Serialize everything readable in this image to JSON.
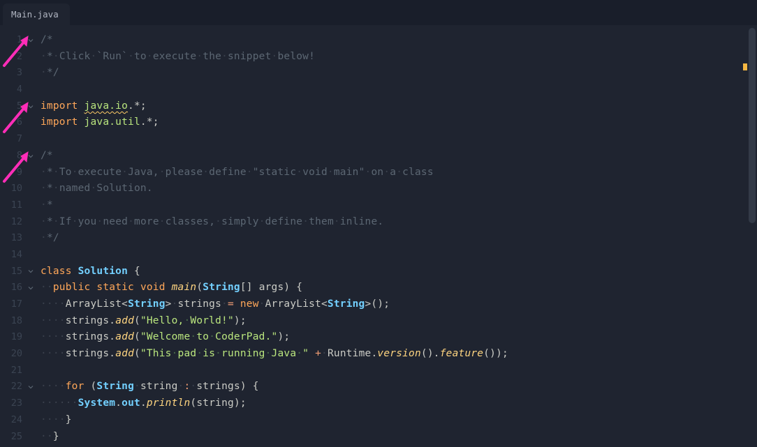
{
  "tab": {
    "filename": "Main.java"
  },
  "lines": [
    {
      "num": 1,
      "fold": true,
      "tokens": [
        [
          "c-comment",
          "/*"
        ]
      ]
    },
    {
      "num": 2,
      "fold": false,
      "tokens": [
        [
          "c-comment",
          " * Click `Run` to execute the snippet below!"
        ]
      ]
    },
    {
      "num": 3,
      "fold": false,
      "tokens": [
        [
          "c-comment",
          " */"
        ]
      ]
    },
    {
      "num": 4,
      "fold": false,
      "tokens": []
    },
    {
      "num": 5,
      "fold": true,
      "tokens": [
        [
          "c-key",
          "import"
        ],
        [
          "c-plain",
          " "
        ],
        [
          "c-ns warn-underline",
          "java.io"
        ],
        [
          "c-punct",
          ".*;"
        ]
      ]
    },
    {
      "num": 6,
      "fold": false,
      "tokens": [
        [
          "c-key",
          "import"
        ],
        [
          "c-plain",
          " "
        ],
        [
          "c-ns",
          "java.util"
        ],
        [
          "c-punct",
          ".*;"
        ]
      ]
    },
    {
      "num": 7,
      "fold": false,
      "tokens": []
    },
    {
      "num": 8,
      "fold": true,
      "tokens": [
        [
          "c-comment",
          "/*"
        ]
      ]
    },
    {
      "num": 9,
      "fold": false,
      "tokens": [
        [
          "c-comment",
          " * To execute Java, please define \"static void main\" on a class"
        ]
      ]
    },
    {
      "num": 10,
      "fold": false,
      "tokens": [
        [
          "c-comment",
          " * named Solution."
        ]
      ]
    },
    {
      "num": 11,
      "fold": false,
      "tokens": [
        [
          "c-comment",
          " *"
        ]
      ]
    },
    {
      "num": 12,
      "fold": false,
      "tokens": [
        [
          "c-comment",
          " * If you need more classes, simply define them inline."
        ]
      ]
    },
    {
      "num": 13,
      "fold": false,
      "tokens": [
        [
          "c-comment",
          " */"
        ]
      ]
    },
    {
      "num": 14,
      "fold": false,
      "tokens": []
    },
    {
      "num": 15,
      "fold": true,
      "tokens": [
        [
          "c-key",
          "class"
        ],
        [
          "c-plain",
          " "
        ],
        [
          "c-type",
          "Solution"
        ],
        [
          "c-plain",
          " "
        ],
        [
          "c-punct",
          "{"
        ]
      ]
    },
    {
      "num": 16,
      "fold": true,
      "indent": 1,
      "tokens": [
        [
          "c-key",
          "public"
        ],
        [
          "c-plain",
          " "
        ],
        [
          "c-key",
          "static"
        ],
        [
          "c-plain",
          " "
        ],
        [
          "c-key",
          "void"
        ],
        [
          "c-plain",
          " "
        ],
        [
          "c-meth-def",
          "main"
        ],
        [
          "c-punct",
          "("
        ],
        [
          "c-type",
          "String"
        ],
        [
          "c-punct",
          "[]"
        ],
        [
          "c-plain",
          " "
        ],
        [
          "c-plain",
          "args"
        ],
        [
          "c-punct",
          ")"
        ],
        [
          "c-plain",
          " "
        ],
        [
          "c-punct",
          "{"
        ]
      ]
    },
    {
      "num": 17,
      "fold": false,
      "indent": 2,
      "tokens": [
        [
          "c-plain",
          "ArrayList"
        ],
        [
          "c-punct",
          "<"
        ],
        [
          "c-type",
          "String"
        ],
        [
          "c-punct",
          ">"
        ],
        [
          "c-plain",
          " strings "
        ],
        [
          "c-op",
          "="
        ],
        [
          "c-plain",
          " "
        ],
        [
          "c-key",
          "new"
        ],
        [
          "c-plain",
          " ArrayList"
        ],
        [
          "c-punct",
          "<"
        ],
        [
          "c-type",
          "String"
        ],
        [
          "c-punct",
          ">();"
        ]
      ]
    },
    {
      "num": 18,
      "fold": false,
      "indent": 2,
      "tokens": [
        [
          "c-plain",
          "strings"
        ],
        [
          "c-punct",
          "."
        ],
        [
          "c-meth",
          "add"
        ],
        [
          "c-punct",
          "("
        ],
        [
          "c-str",
          "\"Hello, World!\""
        ],
        [
          "c-punct",
          ");"
        ]
      ]
    },
    {
      "num": 19,
      "fold": false,
      "indent": 2,
      "tokens": [
        [
          "c-plain",
          "strings"
        ],
        [
          "c-punct",
          "."
        ],
        [
          "c-meth",
          "add"
        ],
        [
          "c-punct",
          "("
        ],
        [
          "c-str",
          "\"Welcome to CoderPad.\""
        ],
        [
          "c-punct",
          ");"
        ]
      ]
    },
    {
      "num": 20,
      "fold": false,
      "indent": 2,
      "tokens": [
        [
          "c-plain",
          "strings"
        ],
        [
          "c-punct",
          "."
        ],
        [
          "c-meth",
          "add"
        ],
        [
          "c-punct",
          "("
        ],
        [
          "c-str",
          "\"This pad is running Java \""
        ],
        [
          "c-plain",
          " "
        ],
        [
          "c-op",
          "+"
        ],
        [
          "c-plain",
          " Runtime"
        ],
        [
          "c-punct",
          "."
        ],
        [
          "c-meth",
          "version"
        ],
        [
          "c-punct",
          "()."
        ],
        [
          "c-meth",
          "feature"
        ],
        [
          "c-punct",
          "());"
        ]
      ]
    },
    {
      "num": 21,
      "fold": false,
      "indent": 0,
      "tokens": []
    },
    {
      "num": 22,
      "fold": true,
      "indent": 2,
      "tokens": [
        [
          "c-key",
          "for"
        ],
        [
          "c-plain",
          " "
        ],
        [
          "c-punct",
          "("
        ],
        [
          "c-type",
          "String"
        ],
        [
          "c-plain",
          " string "
        ],
        [
          "c-op",
          ":"
        ],
        [
          "c-plain",
          " strings"
        ],
        [
          "c-punct",
          ")"
        ],
        [
          "c-plain",
          " "
        ],
        [
          "c-punct",
          "{"
        ]
      ]
    },
    {
      "num": 23,
      "fold": false,
      "indent": 3,
      "tokens": [
        [
          "c-sysout",
          "System"
        ],
        [
          "c-punct",
          "."
        ],
        [
          "c-sysout",
          "out"
        ],
        [
          "c-punct",
          "."
        ],
        [
          "c-meth",
          "println"
        ],
        [
          "c-punct",
          "("
        ],
        [
          "c-plain",
          "string"
        ],
        [
          "c-punct",
          ");"
        ]
      ]
    },
    {
      "num": 24,
      "fold": false,
      "indent": 2,
      "tokens": [
        [
          "c-punct",
          "}"
        ]
      ]
    },
    {
      "num": 25,
      "fold": false,
      "indent": 1,
      "tokens": [
        [
          "c-punct",
          "}"
        ]
      ]
    }
  ],
  "annotations": {
    "arrows_at_lines": [
      1,
      5,
      8
    ]
  },
  "colors": {
    "background": "#1f2430",
    "keyword": "#ffa759",
    "type": "#73d0ff",
    "string": "#bae67e",
    "comment": "#5c6773",
    "arrow": "#ff2db8"
  }
}
